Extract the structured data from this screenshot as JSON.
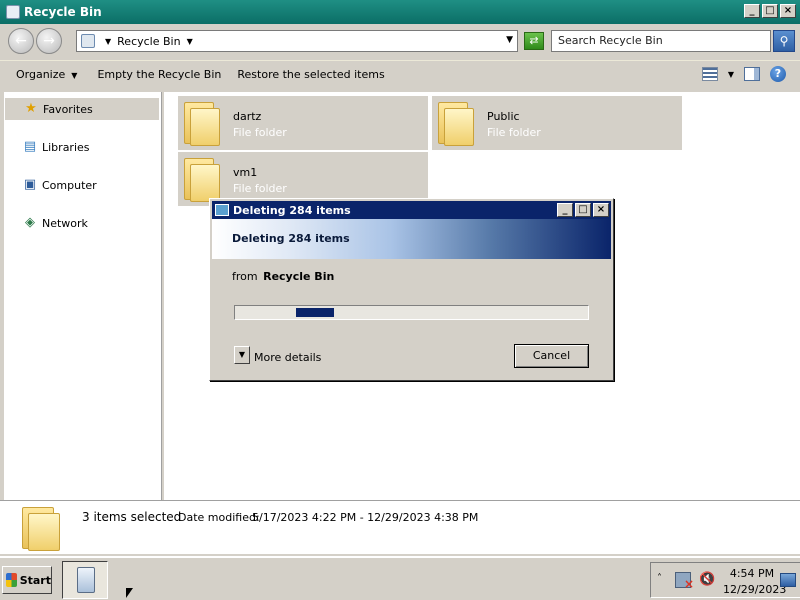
{
  "window": {
    "title": "Recycle Bin",
    "controls": {
      "minimize": "_",
      "maximize": "□",
      "close": "×"
    }
  },
  "address": {
    "crumb": "Recycle Bin",
    "search_placeholder": "Search Recycle Bin",
    "icons": {
      "back": "back-arrow-icon",
      "forward": "forward-arrow-icon",
      "refresh": "refresh-icon",
      "search": "magnifier-icon"
    }
  },
  "toolbar": {
    "organize": "Organize",
    "empty": "Empty the Recycle Bin",
    "restore": "Restore the selected items",
    "help": "?"
  },
  "sidebar": {
    "items": [
      {
        "label": "Favorites",
        "icon": "star-icon"
      },
      {
        "label": "Libraries",
        "icon": "libraries-icon"
      },
      {
        "label": "Computer",
        "icon": "computer-icon"
      },
      {
        "label": "Network",
        "icon": "network-icon"
      }
    ]
  },
  "content": {
    "items": [
      {
        "name": "dartz",
        "type": "File folder"
      },
      {
        "name": "Public",
        "type": "File folder"
      },
      {
        "name": "vm1",
        "type": "File folder"
      }
    ]
  },
  "details": {
    "selected_count": "3 items selected",
    "date_label": "Date modified:",
    "date_value": "5/17/2023 4:22 PM - 12/29/2023 4:38 PM"
  },
  "dialog": {
    "title": "Deleting 284 items",
    "header": "Deleting 284 items",
    "from_label": "from",
    "from_location": "Recycle Bin",
    "more_details": "More details",
    "cancel": "Cancel",
    "progress_state": "marquee (indeterminate)"
  },
  "taskbar": {
    "start_label": "Start",
    "clock_time": "4:54 PM",
    "clock_date": "12/29/2023",
    "tray_chevron": "˄"
  },
  "colors": {
    "title_bar": "#0b6e66",
    "dialog_title": "#0a246a",
    "progress_fill": "#0a246a",
    "window_face": "#d4d0c8"
  }
}
